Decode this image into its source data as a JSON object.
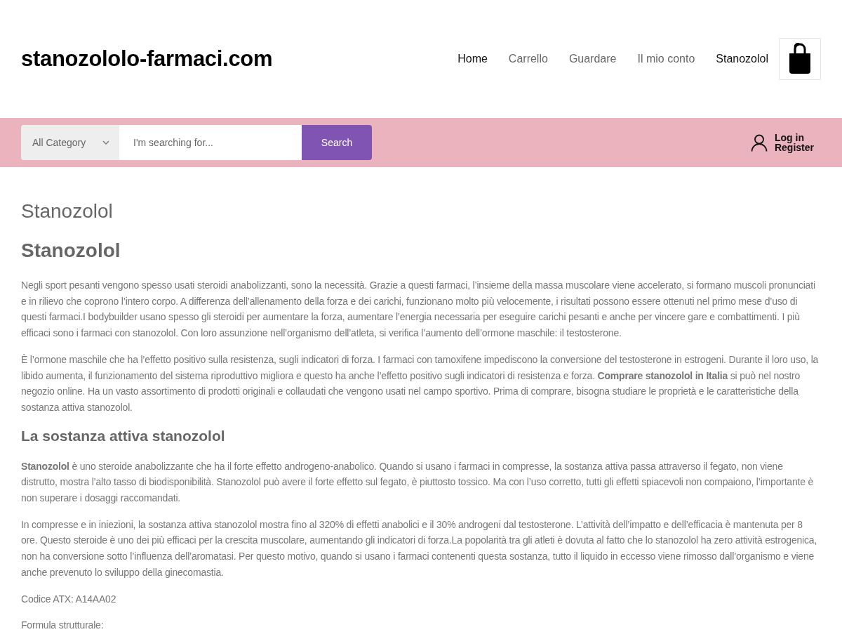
{
  "header": {
    "logo": "stanozololo-farmaci.com",
    "nav": [
      {
        "label": "Home",
        "selected": true
      },
      {
        "label": "Carrello",
        "selected": false
      },
      {
        "label": "Guardare",
        "selected": false
      },
      {
        "label": "Il mio conto",
        "selected": false
      },
      {
        "label": "Stanozolol",
        "selected": true
      }
    ]
  },
  "search_bar": {
    "category": "All Category",
    "placeholder": "I'm searching for...",
    "button": "Search"
  },
  "account": {
    "login": "Log in",
    "register": "Register"
  },
  "content": {
    "page_title": "Stanozolol",
    "blocks": [
      {
        "kind": "title",
        "text": "Stanozolol"
      },
      {
        "kind": "paragraph",
        "text": "Negli sport pesanti vengono spesso usati steroidi anabolizzanti, sono la necessità. Grazie a questi farmaci, l’insieme della massa muscolare viene accelerato, si formano muscoli pronunciati e in rilievo che coprono l’intero corpo. A differenza dell’allenamento della forza e dei carichi, funzionano molto più velocemente, i risultati possono essere ottenuti nel primo mese d’uso di questi farmaci.I bodybuilder usano spesso gli steroidi per aumentare la forza, aumentare l’energia necessaria per eseguire carichi pesanti e anche per vincere gare e combattimenti. I più efficaci sono i farmaci con stanozolol. Con loro assunzione nell’organismo dell’atleta, si verifica l’aumento dell’ormone maschile: il testosterone."
      },
      {
        "kind": "paragraph",
        "text": "È l’ormone maschile che ha l’effetto positivo sulla resistenza, sugli indicatori di forza. I farmaci con tamoxifene impediscono la conversione del testosterone in estrogeni. Durante il loro uso, la libido aumenta, il funzionamento del sistema riproduttivo migliora e questo ha anche l’effetto positivo sugli indicatori di resistenza e forza. **Comprare stanozolol in Italia** si può nel nostro negozio online. Ha un vasto assortimento di prodotti originali e collaudati che vengono usati nel campo sportivo. Prima di comprare, bisogna studiare le proprietà e le caratteristiche della sostanza attiva stanozolol."
      },
      {
        "kind": "heading",
        "text": "La sostanza attiva stanozolol"
      },
      {
        "kind": "paragraph",
        "text": "**Stanozolol** è uno steroide anabolizzante che ha il forte effetto androgeno-anabolico. Quando si usano i farmaci in compresse, la sostanza attiva passa attraverso il fegato, non viene distrutto, mostra l’alto tasso di biodisponibilità. Stanozolol può avere il forte effetto sul fegato, è piuttosto tossico. Ma con l’uso corretto, tutti gli effetti spiacevoli non compaiono, l’importante è non superare i dosaggi raccomandati."
      },
      {
        "kind": "paragraph",
        "text": "In compresse e in iniezioni, la sostanza attiva stanozolol mostra fino al 320% di effetti anabolici e il 30% androgeni dal testosterone. L’attività dell’impatto e dell’efficacia è mantenuta per 8 ore. Questo steroide è uno dei più efficaci per la crescita muscolare, aumentando gli indicatori di forza.La popolarità tra gli atleti è dovuta al fatto che lo stanozolol ha zero attività estrogenica, non ha conversione sotto l’influenza dell’aromatasi. Per questo motivo, quando si usano i farmaci contenenti questa sostanza, tutto il liquido in eccesso viene rimosso dall’organismo e viene anche prevenuto lo sviluppo della ginecomastia."
      },
      {
        "kind": "paragraph",
        "text": "Codice ATX: A14AA02"
      },
      {
        "kind": "paragraph",
        "text": "Formula strutturale:"
      }
    ]
  }
}
